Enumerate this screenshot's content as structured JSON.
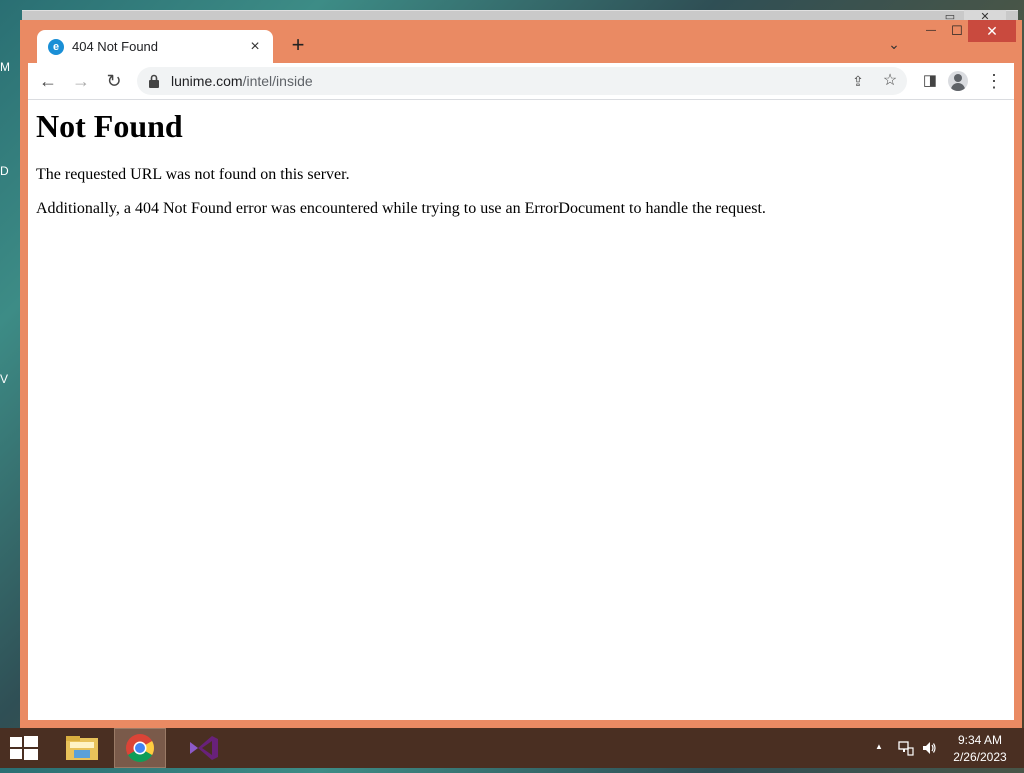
{
  "desktop": {
    "labels": [
      "M",
      "D",
      "V"
    ]
  },
  "browser": {
    "tab": {
      "title": "404 Not Found",
      "close": "×"
    },
    "new_tab": "+",
    "tab_search": "⌄",
    "window_controls": {
      "minimize": "—",
      "maximize": "☐",
      "close": "✕"
    },
    "toolbar": {
      "back": "←",
      "forward": "→",
      "reload": "↻",
      "url_host": "lunime.com",
      "url_path": "/intel/inside",
      "share": "⇪",
      "bookmark": "☆",
      "side_panel": "◨",
      "menu": "⋮"
    }
  },
  "page": {
    "heading": "Not Found",
    "line1": "The requested URL was not found on this server.",
    "line2": "Additionally, a 404 Not Found error was encountered while trying to use an ErrorDocument to handle the request."
  },
  "taskbar": {
    "apps": [
      "file-explorer",
      "chrome",
      "visual-studio"
    ],
    "tray": {
      "up_arrow": "▲",
      "time": "9:34 AM",
      "date": "2/26/2023"
    }
  },
  "colors": {
    "window_frame": "#ea8a63",
    "close_red": "#c94a3e",
    "taskbar": "#4a2f22"
  }
}
